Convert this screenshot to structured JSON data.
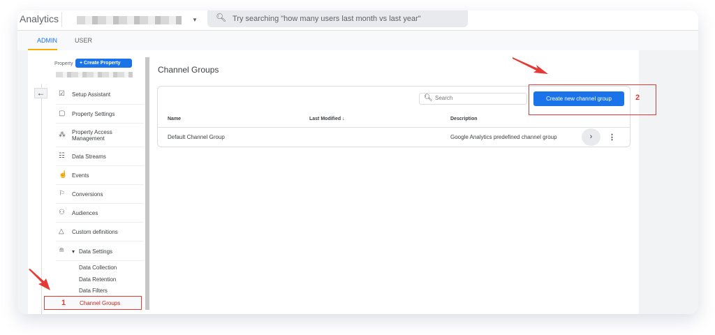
{
  "header": {
    "brand": "Analytics",
    "search_placeholder": "Try searching \"how many users last month vs last year\""
  },
  "tabs": [
    {
      "label": "ADMIN",
      "active": true
    },
    {
      "label": "USER",
      "active": false
    }
  ],
  "sidebar": {
    "property_label": "Property",
    "create_property": "Create Property",
    "items": [
      {
        "label": "Setup Assistant",
        "icon": "checklist-icon"
      },
      {
        "label": "Property Settings",
        "icon": "window-icon"
      },
      {
        "label": "Property Access Management",
        "icon": "people-icon"
      },
      {
        "label": "Data Streams",
        "icon": "streams-icon"
      },
      {
        "label": "Events",
        "icon": "touch-icon"
      },
      {
        "label": "Conversions",
        "icon": "flag-icon"
      },
      {
        "label": "Audiences",
        "icon": "audience-icon"
      },
      {
        "label": "Custom definitions",
        "icon": "shapes-icon"
      },
      {
        "label": "Data Settings",
        "icon": "database-icon"
      }
    ],
    "sub_items": [
      "Data Collection",
      "Data Retention",
      "Data Filters",
      "Channel Groups"
    ],
    "active": "Channel Groups"
  },
  "main": {
    "title": "Channel Groups",
    "search_placeholder": "Search",
    "create_button": "Create new channel group",
    "columns": [
      "Name",
      "Last Modified",
      "Description"
    ],
    "rows": [
      {
        "name": "Default Channel Group",
        "last_modified": "",
        "description": "Google Analytics predefined channel group"
      }
    ]
  },
  "annotations": {
    "step1": "1",
    "step2": "2",
    "color": "#e53935"
  },
  "colors": {
    "accent": "#1a73e8",
    "tab_indicator": "#f9ab00"
  }
}
